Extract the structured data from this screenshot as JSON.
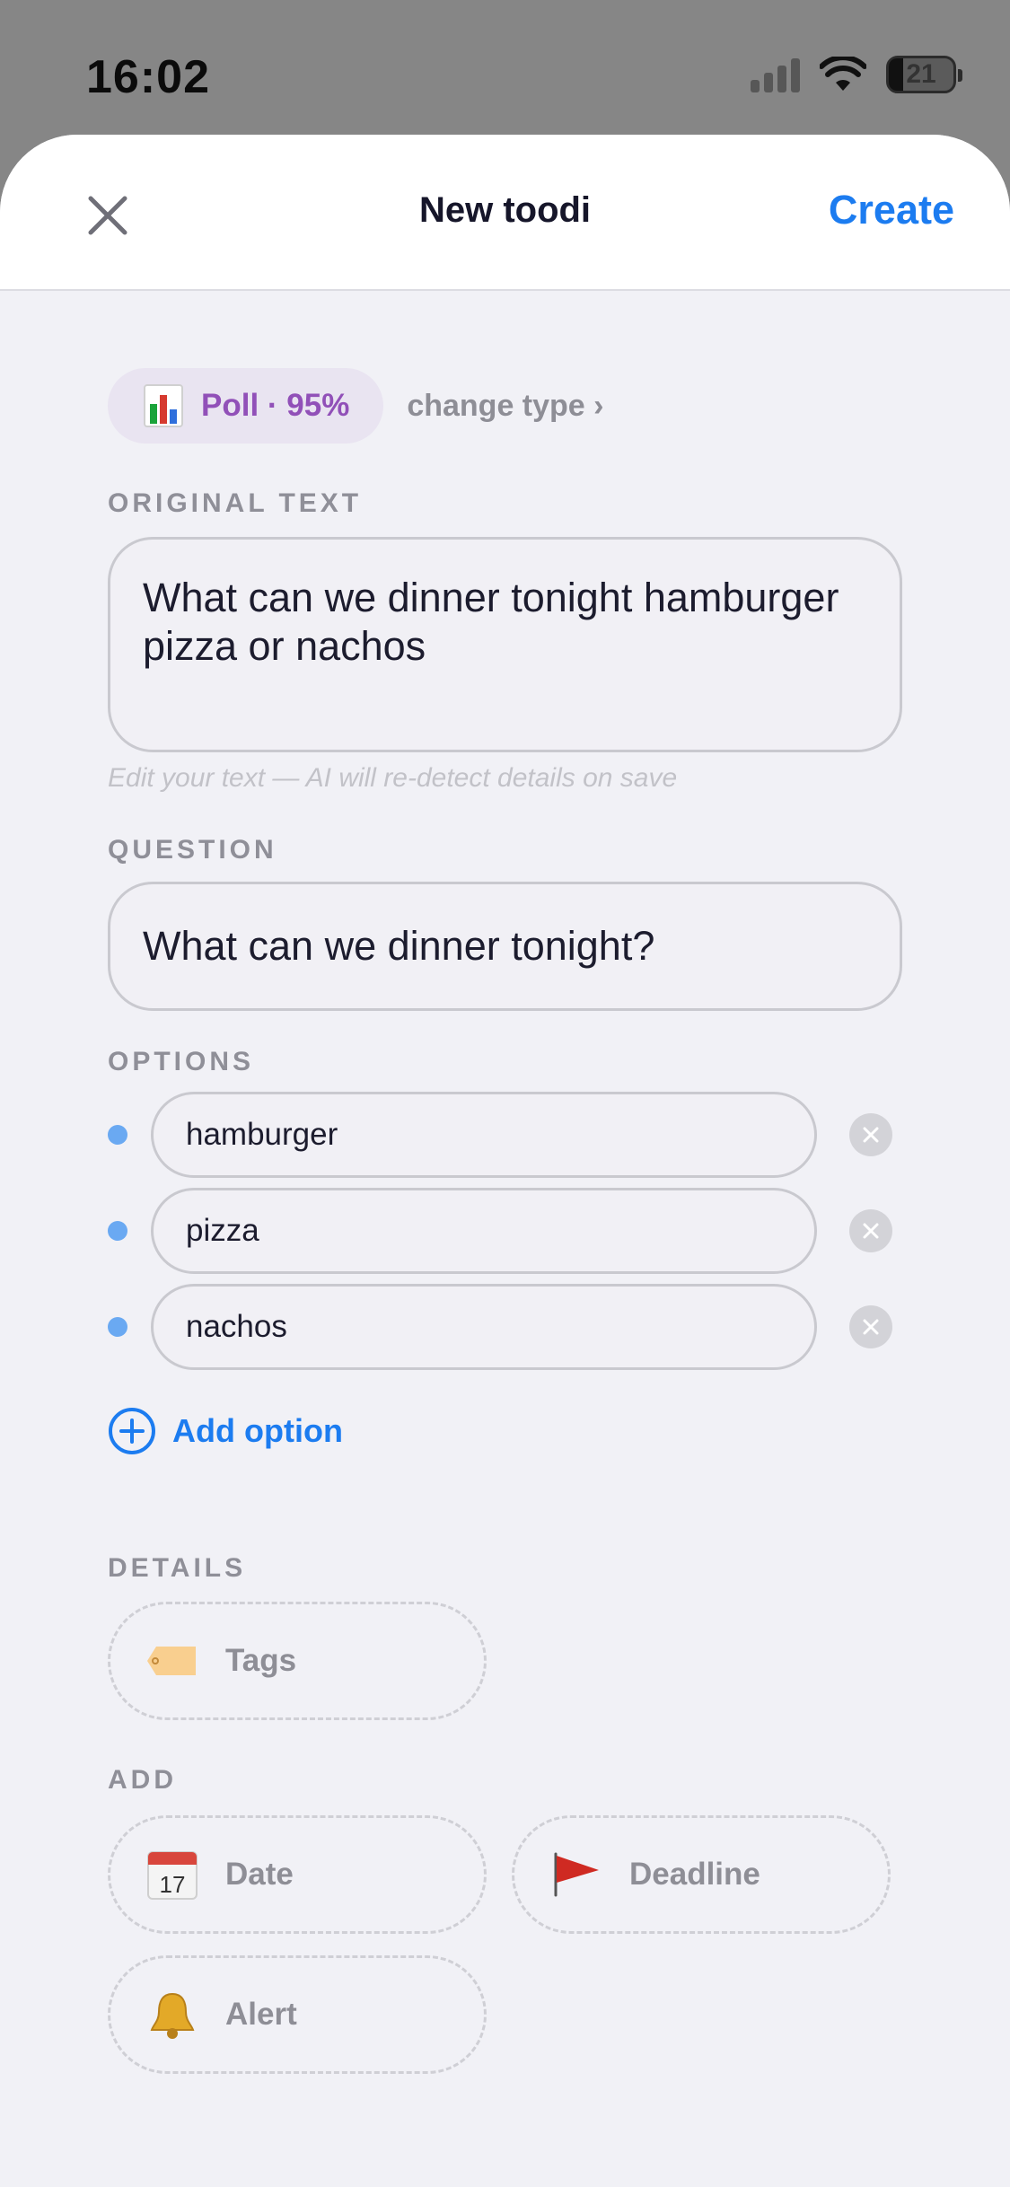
{
  "status_bar": {
    "time": "16:02",
    "battery": "21"
  },
  "header": {
    "title": "New toodi",
    "create_label": "Create"
  },
  "type": {
    "label": "Poll · 95%",
    "change_label": "change type ›"
  },
  "original_text": {
    "label": "ORIGINAL TEXT",
    "value": "What can we dinner tonight hamburger pizza or nachos",
    "hint": "Edit your text — AI will re-detect details on save"
  },
  "question": {
    "label": "QUESTION",
    "value": "What can we dinner tonight?"
  },
  "options": {
    "label": "OPTIONS",
    "items": [
      {
        "value": "hamburger"
      },
      {
        "value": "pizza"
      },
      {
        "value": "nachos"
      }
    ],
    "add_label": "Add option"
  },
  "details": {
    "label": "DETAILS",
    "tags_label": "Tags"
  },
  "add": {
    "label": "ADD",
    "date_label": "Date",
    "deadline_label": "Deadline",
    "alert_label": "Alert"
  },
  "colors": {
    "accent": "#1c7cf0",
    "poll": "#9150b8",
    "bullet": "#6aa9f2"
  }
}
